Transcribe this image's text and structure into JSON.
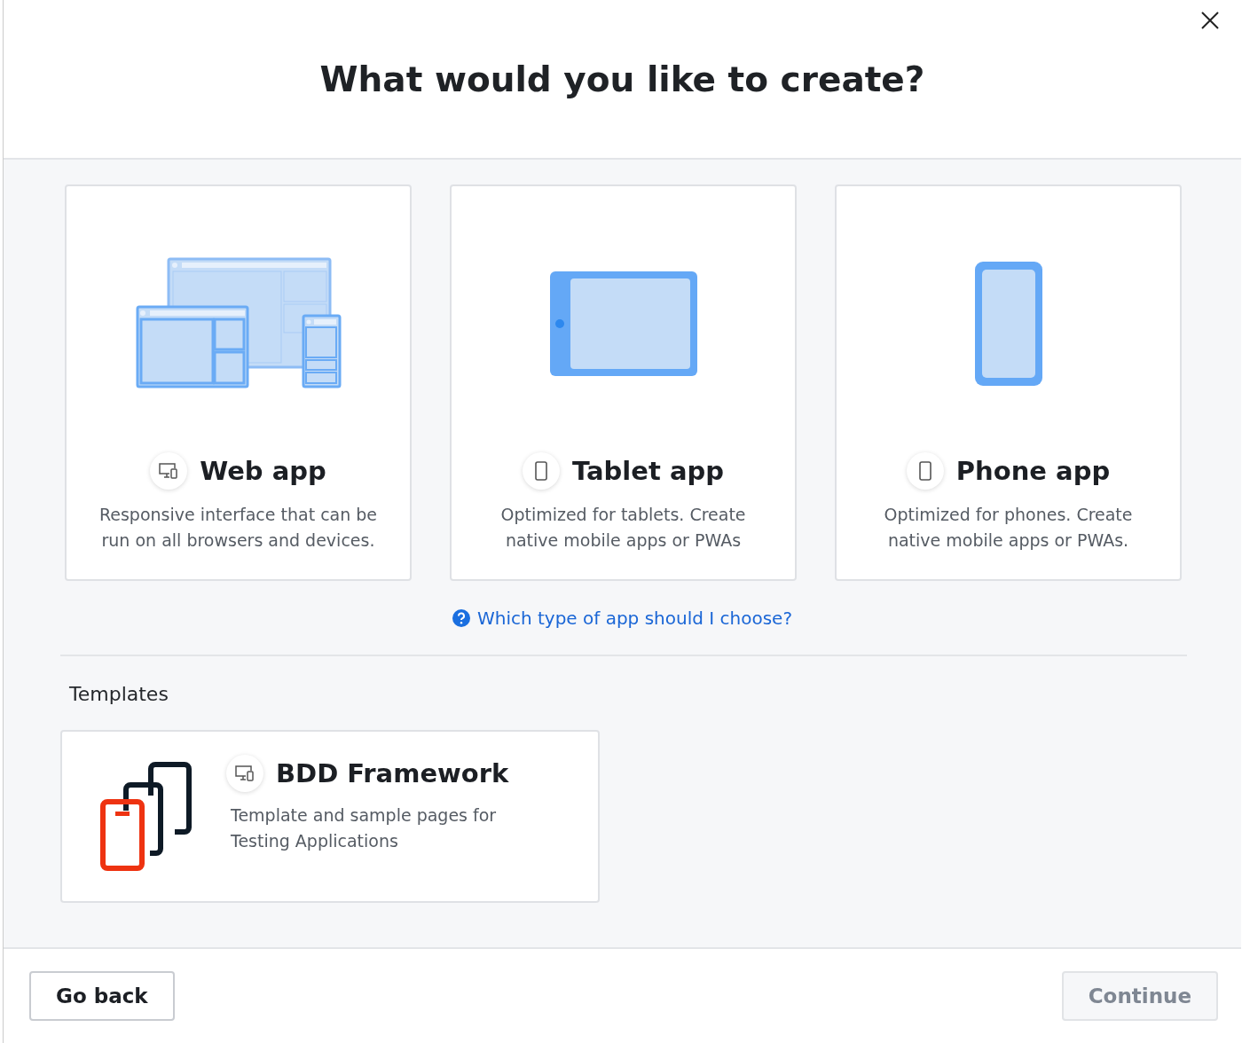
{
  "dialog": {
    "title": "What would you like to create?"
  },
  "app_types": [
    {
      "kind": "web",
      "title": "Web app",
      "description": "Responsive interface that can be run on all browsers and devices."
    },
    {
      "kind": "tablet",
      "title": "Tablet app",
      "description": "Optimized for tablets. Create native mobile apps or PWAs"
    },
    {
      "kind": "phone",
      "title": "Phone app",
      "description": "Optimized for phones. Create native mobile apps or PWAs."
    }
  ],
  "help_link": "Which type of app should I choose?",
  "templates": {
    "heading": "Templates",
    "items": [
      {
        "kind": "web",
        "title": "BDD Framework",
        "description": "Template and sample pages for Testing Applications"
      }
    ]
  },
  "footer": {
    "buttons": [
      {
        "label": "Go back",
        "disabled": false
      },
      {
        "label": "Continue",
        "disabled": true
      }
    ]
  }
}
